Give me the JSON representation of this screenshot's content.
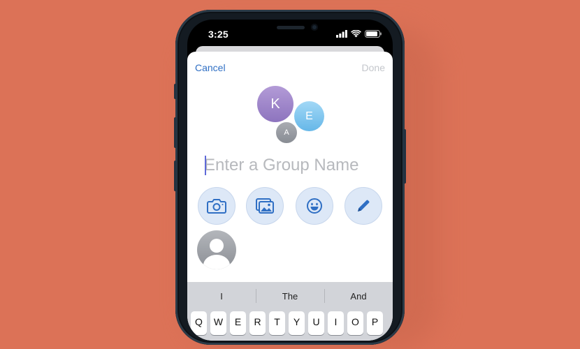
{
  "status_bar": {
    "time": "3:25",
    "icons": [
      "signal-icon",
      "wifi-icon",
      "battery-icon"
    ]
  },
  "nav": {
    "cancel_label": "Cancel",
    "done_label": "Done"
  },
  "avatars": [
    {
      "initial": "K",
      "color": "#9a80c8"
    },
    {
      "initial": "E",
      "color": "#7cc3ee"
    },
    {
      "initial": "A",
      "color": "#979aa0"
    }
  ],
  "group_name": {
    "placeholder": "Enter a Group Name",
    "value": ""
  },
  "actions": [
    {
      "name": "camera-icon"
    },
    {
      "name": "photos-icon"
    },
    {
      "name": "emoji-icon"
    },
    {
      "name": "pencil-icon"
    }
  ],
  "keyboard": {
    "suggestions": [
      "I",
      "The",
      "And"
    ],
    "top_row": [
      "Q",
      "W",
      "E",
      "R",
      "T",
      "Y",
      "U",
      "I",
      "O",
      "P"
    ]
  },
  "colors": {
    "background": "#dc7257",
    "accent": "#2f6fc4",
    "action_bg": "#dde8f7"
  }
}
